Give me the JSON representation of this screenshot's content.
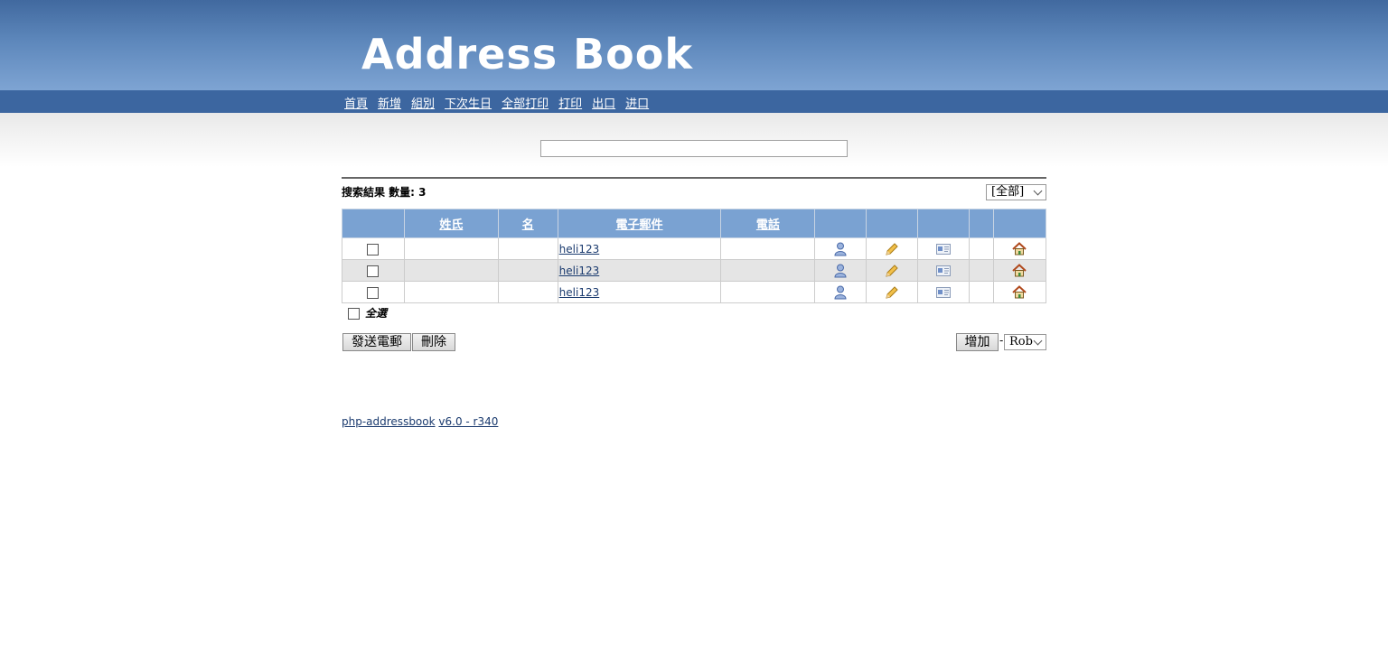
{
  "header": {
    "logo_text": "Address Book"
  },
  "nav": {
    "items": [
      {
        "label": "首頁"
      },
      {
        "label": "新增"
      },
      {
        "label": "組別"
      },
      {
        "label": "下次生日"
      },
      {
        "label": "全部打印"
      },
      {
        "label": "打印"
      },
      {
        "label": "出口"
      },
      {
        "label": "进口"
      }
    ]
  },
  "search": {
    "value": ""
  },
  "results": {
    "label": "搜索結果 數量: 3"
  },
  "group_select": {
    "selected": "[全部]"
  },
  "table": {
    "headers": {
      "last_name": "姓氏",
      "first_name": "名",
      "email": "電子郵件",
      "phone": "電話"
    },
    "rows": [
      {
        "last_name": "",
        "first_name": "",
        "email": "heli123",
        "phone": ""
      },
      {
        "last_name": "",
        "first_name": "",
        "email": "heli123",
        "phone": ""
      },
      {
        "last_name": "",
        "first_name": "",
        "email": "heli123",
        "phone": ""
      }
    ],
    "row_icons": [
      "person-icon",
      "pencil-icon",
      "vcard-icon",
      "home-icon"
    ]
  },
  "select_all": {
    "label": "全選"
  },
  "buttons": {
    "send_email": "發送電郵",
    "delete": "刪除",
    "add": "增加",
    "separator": "-"
  },
  "add_to_select": {
    "selected": "Rob"
  },
  "footer": {
    "app_name": "php-addressbook",
    "version": "v6.0 - r340"
  },
  "colors": {
    "header_blue": "#41699f",
    "nav_blue": "#3c66a0",
    "table_header": "#7aa2d2",
    "alt_row": "#e5e5e5"
  }
}
